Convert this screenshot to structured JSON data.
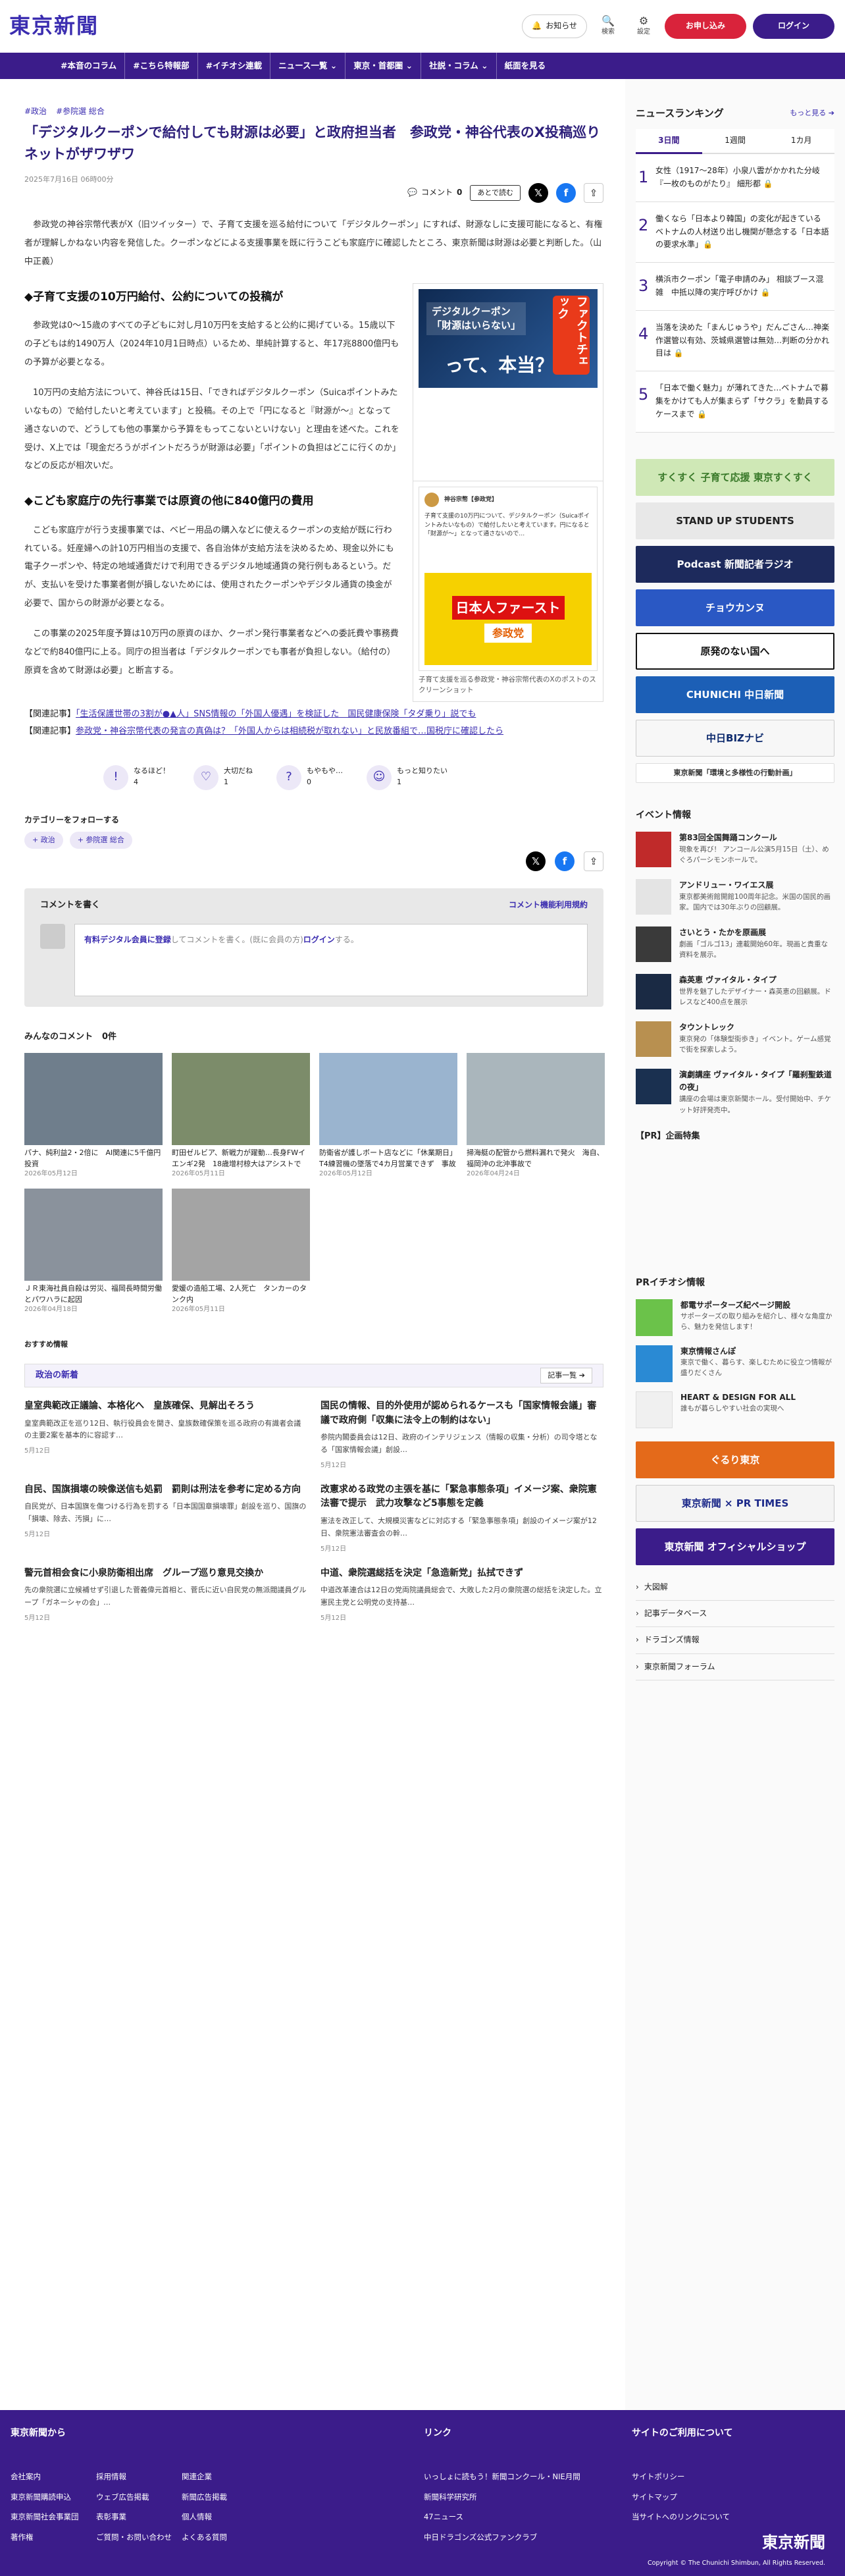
{
  "header": {
    "logo": "東京新聞",
    "notice": "お知らせ",
    "search": "検索",
    "settings": "設定",
    "apply": "お申し込み",
    "login": "ログイン"
  },
  "nav": [
    "#本音のコラム",
    "#こちら特報部",
    "#イチオシ連載",
    "ニュース一覧 ⌄",
    "東京・首都圏 ⌄",
    "社説・コラム ⌄",
    "紙面を見る"
  ],
  "article": {
    "tags": [
      "#政治",
      "#参院選 総合"
    ],
    "title": "「デジタルクーポンで給付しても財源は必要」と政府担当者　参政党・神谷代表のX投稿巡りネットがザワザワ",
    "date": "2025年7月16日 06時00分",
    "comment_label": "コメント",
    "comment_count": "0",
    "later": "あとで読む",
    "lead": "参政党の神谷宗幣代表がX（旧ツイッター）で、子育て支援を巡る給付について「デジタルクーポン」にすれば、財源なしに支援可能になると、有権者が理解しかねない内容を発信した。クーポンなどによる支援事業を既に行うこども家庭庁に確認したところ、東京新聞は財源は必要と判断した。（山中正義）",
    "h1": "◆子育て支援の10万円給付、公約についての投稿が",
    "p1": "参政党は0～15歳のすべての子どもに対し月10万円を支給すると公約に掲げている。15歳以下の子どもは約1490万人（2024年10月1日時点）いるため、単純計算すると、年17兆8800億円もの予算が必要となる。",
    "p2": "10万円の支給方法について、神谷氏は15日、「できればデジタルクーポン（Suicaポイントみたいなもの）で給付したいと考えています」と投稿。その上で「円になると『財源が～』となって通さないので、どうしても他の事業から予算をもってこないといけない」と理由を述べた。これを受け、X上では「現金だろうがポイントだろうが財源は必要」「ポイントの負担はどこに行くのか」などの反応が相次いだ。",
    "h2": "◆こども家庭庁の先行事業では原資の他に840億円の費用",
    "p3": "こども家庭庁が行う支援事業では、ベビー用品の購入などに使えるクーポンの支給が既に行われている。妊産婦への計10万円相当の支援で、各自治体が支給方法を決めるため、現金以外にも電子クーポンや、特定の地域通貨だけで利用できるデジタル地域通貨の発行例もあるという。だが、支払いを受けた事業者側が損しないためには、使用されたクーポンやデジタル通貨の換金が必要で、国からの財源が必要となる。",
    "p4": "この事業の2025年度予算は10万円の原資のほか、クーポン発行事業者などへの委託費や事務費などで約840億円に上る。同庁の担当者は「デジタルクーポンでも事者が負担しない。（給付の）原資を含めて財源は必要」と断言する。",
    "fig1_t1": "デジタルクーポン",
    "fig1_t2": "「財源はいらない」",
    "fig1_t3": "って、本当？",
    "fig1_side": "ファクトチェック",
    "fig2_name": "神谷宗幣【参政党】",
    "fig2_text": "子育て支援の10万円について、デジタルクーポン（Suicaポイントみたいなもの）で給付したいと考えています。円になると「財源が～」となって通さないので…",
    "fig2_poster1": "日本人ファースト",
    "fig2_poster2": "参政党",
    "fig2_caption": "子育て支援を巡る参政党・神谷宗幣代表のXのポストのスクリーンショット",
    "related": [
      {
        "label": "【関連記事】",
        "text": "「生活保護世帯の3割が●▲人」SNS情報の「外国人優遇」を検証した　国民健康保険「タダ乗り」説でも"
      },
      {
        "label": "【関連記事】",
        "text": "参政党・神谷宗幣代表の発言の真偽は？「外国人からは相続税が取れない」と民放番組で…国税庁に確認したら"
      }
    ],
    "reactions": [
      {
        "icon": "!",
        "label": "なるほど！",
        "count": "4"
      },
      {
        "icon": "♡",
        "label": "大切だね",
        "count": "1"
      },
      {
        "icon": "?",
        "label": "もやもや…",
        "count": "0"
      },
      {
        "icon": "☺",
        "label": "もっと知りたい",
        "count": "1"
      }
    ],
    "follow": "カテゴリーをフォローする",
    "follow_chips": [
      "+ 政治",
      "+ 参院選 総合"
    ],
    "comment_write": "コメントを書く",
    "comment_rules": "コメント機能利用規約",
    "comment_placeholder_a": "有料デジタル会員に登録",
    "comment_placeholder_b": "してコメントを書く。(既に会員の方)",
    "comment_placeholder_c": "ログイン",
    "comment_placeholder_d": "する。",
    "everyone": "みんなのコメント",
    "everyone_count": "0件",
    "thumbs": [
      {
        "cap": "パナ、純利益2・2倍に　AI関連に5千億円投資",
        "dt": "2026年05月12日",
        "bg": "#6f7e8c"
      },
      {
        "cap": "町田ゼルビア、新戦力が躍動…長身FWイエンギ2発　18歳增村椋大はアシストでデ…",
        "dt": "2026年05月11日",
        "bg": "#7c8c6a"
      },
      {
        "cap": "防衛省が護しボート店などに「休業期日」T4練習機の墜落で4カ月営業できず　事故原因…",
        "dt": "2026年05月12日",
        "bg": "#9ab4cf"
      },
      {
        "cap": "掃海艇の配管から燃料漏れで発火　海自、福岡沖の北沖事故で",
        "dt": "2026年04月24日",
        "bg": "#aab6bc"
      },
      {
        "cap": "ＪＲ東海社員自殺は労災、福岡長時間労働とパワハラに起因",
        "dt": "2026年04月18日",
        "bg": "#8a929c"
      },
      {
        "cap": "愛媛の造船工場、2人死亡　タンカーのタンク内",
        "dt": "2026年05月11日",
        "bg": "#a4a4a4"
      }
    ],
    "osusume": "おすすめ情報",
    "politics": "政治の新着",
    "more": "記事一覧 ➔",
    "news": [
      {
        "t": "皇室典範改正議論、本格化へ　皇族確保、見解出そろう",
        "s": "皇室典範改正を巡り12日、執行役員会を開き、皇族数確保策を巡る政府の有識者会議の主要2案を基本的に容認す…",
        "d": "5月12日"
      },
      {
        "t": "国民の情報、目的外使用が認められるケースも「国家情報会議」審議で政府側「収集に法令上の制約はない」",
        "s": "参院内閣委員会は12日、政府のインテリジェンス（情報の収集・分析）の司令塔となる「国家情報会議」創設…",
        "d": "5月12日"
      },
      {
        "t": "自民、国旗損壊の映像送信も処罰　罰則は刑法を参考に定める方向",
        "s": "自民党が、日本国旗を傷つける行為を罰する「日本国国章損壊罪」創設を巡り、国旗の「損壊、除去、汚損」に…",
        "d": "5月12日"
      },
      {
        "t": "改憲求める政党の主張を基に「緊急事態条項」イメージ案、衆院憲法審で提示　武力攻撃など5事態を定義",
        "s": "憲法を改正して、大規模災害などに対応する「緊急事態条項」創設のイメージ案が12日、衆院憲法審査会の幹…",
        "d": "5月12日"
      },
      {
        "t": "警元首相会食に小泉防衛相出席　グループ巡り意見交換か",
        "s": "先の衆院選に立候補せず引退した菅義偉元首相と、菅氏に近い自民党の無派閥議員グループ「ガネーシャの会」…",
        "d": "5月12日"
      },
      {
        "t": "中道、衆院選総括を決定「急造新党」払拭できず",
        "s": "中道改革連合は12日の党両院議員総会で、大敗した2月の衆院選の総括を決定した。立憲民主党と公明党の支持基…",
        "d": "5月12日"
      }
    ]
  },
  "side": {
    "ranking": "ニュースランキング",
    "more": "もっと見る ➔",
    "tabs": [
      "3日間",
      "1週間",
      "1カ月"
    ],
    "items": [
      {
        "n": "1",
        "t": "女性（1917〜28年）小泉八雲がかかれた分岐 『一枚のものがたり』 細形都 🔒"
      },
      {
        "n": "2",
        "t": "働くなら「日本より韓国」の変化が起きている　ベトナムの人材送り出し機関が懸念する「日本語の要求水準」🔒"
      },
      {
        "n": "3",
        "t": "横浜市クーポン「電子申請のみ」 相談ブース混雑　中抵以降の実庁呼びかけ 🔒"
      },
      {
        "n": "4",
        "t": "当落を決めた「まんじゅうや」だんごさん…神楽作選管以有効、茨城県選管は無効…判断の分かれ目は 🔒"
      },
      {
        "n": "5",
        "t": "「日本で働く魅力」が薄れてきた…ベトナムで募集をかけても人が集まらず「サクラ」を動員するケースまで 🔒"
      }
    ],
    "banners": [
      {
        "t": "すくすく 子育て応援 東京すくすく",
        "bg": "#cfe8b6",
        "c": "#3a7a2a"
      },
      {
        "t": "STAND UP STUDENTS",
        "bg": "#e8e8e8",
        "c": "#222"
      },
      {
        "t": "Podcast 新聞記者ラジオ",
        "bg": "#1d2a5c",
        "c": "#fff"
      },
      {
        "t": "チョウカンヌ",
        "bg": "#2a58c4",
        "c": "#fff"
      },
      {
        "t": "原発のない国へ",
        "bg": "#fff",
        "c": "#111"
      },
      {
        "t": "CHUNICHI 中日新聞",
        "bg": "#1c5fb6",
        "c": "#fff"
      },
      {
        "t": "中日BIZナビ",
        "bg": "#f7f7f7",
        "c": "#0d2a6d"
      },
      {
        "t": "東京新聞「環境と多様性の行動計画」",
        "bg": "#ffffff",
        "c": "#333"
      }
    ],
    "events": "イベント情報",
    "ev": [
      {
        "t": "第83回全国舞踊コンクール",
        "s": "現象を再び！ アンコール公演5月15日（土）、めぐろパーシモンホールで。",
        "bg": "#c02a2a"
      },
      {
        "t": "アンドリュー・ワイエス展",
        "s": "東京都美術館開館100周年記念。米国の国民的画家。国内では30年ぶりの回顧展。",
        "bg": "#e4e4e4"
      },
      {
        "t": "さいとう・たかを原画展",
        "s": "劇画「ゴルゴ13」連載開始60年。現画と貴重な資料を展示。",
        "bg": "#3a3a3a"
      },
      {
        "t": "森英恵 ヴァイタル・タイプ",
        "s": "世界を魅了したデザイナー・森英恵の回顧展。ドレスなど400点を展示",
        "bg": "#1a2a44"
      },
      {
        "t": "タウントレック",
        "s": "東京発の「体験型街歩き」イベント。ゲーム感覚で街を探索しよう。",
        "bg": "#b89050"
      },
      {
        "t": "演劇講座 ヴァイタル・タイプ「羅刹聖鉄道の夜」",
        "s": "講座の会場は東京新聞ホール。受付開始中、チケット好評発売中。",
        "bg": "#1a3050"
      }
    ],
    "pr": "【PR】企画特集",
    "pr_head": "PRイチオシ情報",
    "pri": [
      {
        "t": "都電サポーターズ紀ページ開設",
        "s": "サポーターズの取り組みを紹介し、様々な角度から、魅力を発信します！",
        "bg": "#6bc24a"
      },
      {
        "t": "東京情報さんぽ",
        "s": "東京で働く、暮らす、楽しむために役立つ情報が盛りだくさん",
        "bg": "#2a8ad4"
      },
      {
        "t": "HEART & DESIGN FOR ALL",
        "s": "誰もが暮らしやすい社会の実現へ",
        "bg": "#f0f0f0"
      }
    ],
    "bottom_banners": [
      {
        "t": "ぐるり東京",
        "bg": "#e46a1a",
        "c": "#fff"
      },
      {
        "t": "東京新聞 × PR TIMES",
        "bg": "#f4f4f4",
        "c": "#1d2a8a"
      },
      {
        "t": "東京新聞 オフィシャルショップ",
        "bg": "#3b1c8a",
        "c": "#fff"
      }
    ],
    "links": [
      "大図解",
      "記事データベース",
      "ドラゴンズ情報",
      "東京新聞フォーラム"
    ]
  },
  "footer": {
    "c1": "東京新聞から",
    "c1_links": [
      "会社案内",
      "採用情報",
      "関連企業",
      "東京新聞購読申込",
      "ウェブ広告掲載",
      "新聞広告掲載",
      "東京新聞社会事業団",
      "表彰事業",
      "個人情報",
      "著作権",
      "ご質問・お問い合わせ",
      "よくある質問"
    ],
    "c2": "リンク",
    "c2_links": [
      "いっしょに読もう！新聞コンクール・NIE月間",
      "新聞科学研究所",
      "47ニュース",
      "中日ドラゴンズ公式ファンクラブ"
    ],
    "c3": "サイトのご利用について",
    "c3_links": [
      "サイトポリシー",
      "サイトマップ",
      "当サイトへのリンクについて"
    ],
    "logo": "東京新聞",
    "copyright": "Copyright © The Chunichi Shimbun, All Rights Reserved."
  }
}
